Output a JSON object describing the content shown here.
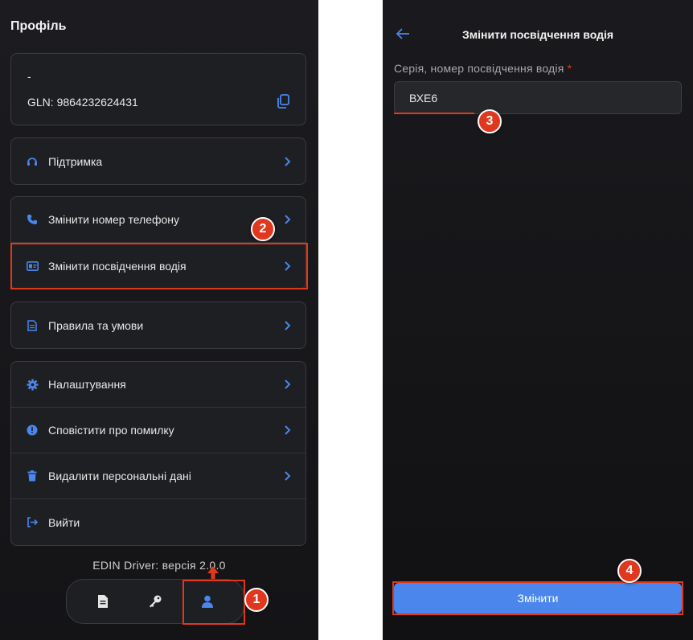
{
  "profile": {
    "title": "Профіль",
    "account": {
      "name": "-",
      "gln": "GLN: 9864232624431"
    },
    "support": {
      "label": "Підтримка"
    },
    "group1": [
      {
        "label": "Змінити номер телефону"
      },
      {
        "label": "Змінити посвідчення водія"
      }
    ],
    "terms": {
      "label": "Правила та умови"
    },
    "group2": [
      {
        "label": "Налаштування"
      },
      {
        "label": "Сповістити про помилку"
      },
      {
        "label": "Видалити персональні дані"
      },
      {
        "label": "Вийти"
      }
    ],
    "version": "EDIN Driver: версія 2.0.0",
    "tabs": [
      "document-icon",
      "key-icon",
      "user-icon"
    ],
    "active_tab": 2
  },
  "license_screen": {
    "title": "Змінити посвідчення водія",
    "field_label": "Серія, номер посвідчення водія",
    "required_mark": "*",
    "field_value": "ВХЕ6",
    "submit_label": "Змінити"
  },
  "badges": [
    "1",
    "2",
    "3",
    "4"
  ],
  "colors": {
    "accent": "#4a86ec",
    "highlight": "#e0371f",
    "background": "#17171a",
    "card": "#1e1f23"
  }
}
